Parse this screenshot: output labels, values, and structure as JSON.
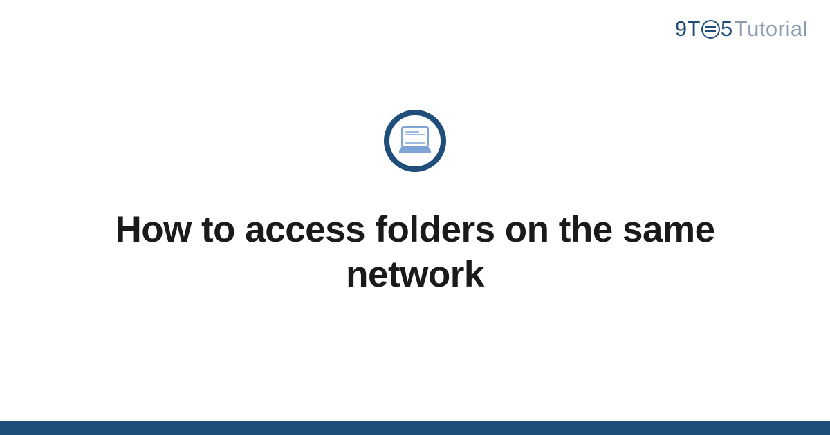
{
  "brand": {
    "part1": "9",
    "part2": "T",
    "part3": "5",
    "part4": "Tutorial"
  },
  "article": {
    "title": "How to access folders on the same network"
  },
  "colors": {
    "brand_primary": "#1e4e79",
    "brand_muted": "#8a9bb0",
    "text": "#1a1a1a",
    "footer": "#1e4e79"
  }
}
